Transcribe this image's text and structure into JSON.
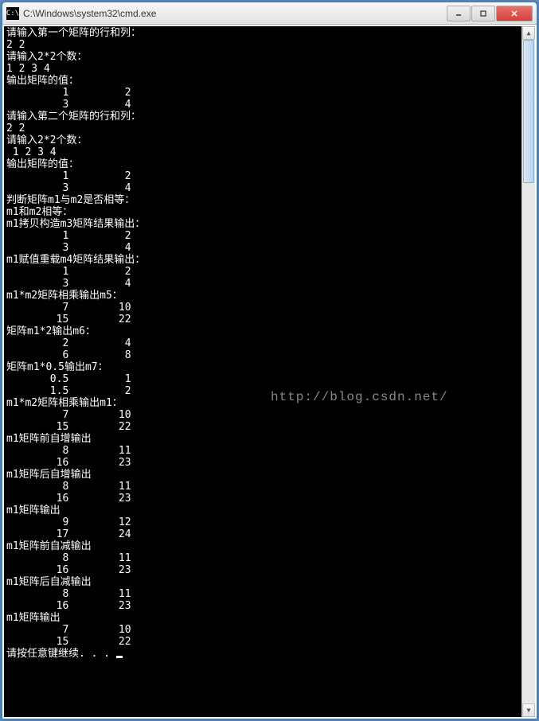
{
  "window": {
    "title": "C:\\Windows\\system32\\cmd.exe",
    "icon_label": "C:\\"
  },
  "controls": {
    "minimize": "—",
    "maximize": "▢",
    "close": "✕"
  },
  "watermark": "http://blog.csdn.net/",
  "console_lines": [
    "请输入第一个矩阵的行和列：",
    "2 2",
    "请输入2*2个数：",
    "1 2 3 4",
    "输出矩阵的值：",
    "         1         2",
    "         3         4",
    "请输入第二个矩阵的行和列：",
    "2 2",
    "请输入2*2个数：",
    " 1 2 3 4",
    "输出矩阵的值：",
    "         1         2",
    "         3         4",
    "判断矩阵m1与m2是否相等：",
    "m1和m2相等：",
    "m1拷贝构造m3矩阵结果输出：",
    "         1         2",
    "         3         4",
    "m1赋值重载m4矩阵结果输出：",
    "         1         2",
    "         3         4",
    "m1*m2矩阵相乘输出m5：",
    "         7        10",
    "        15        22",
    "矩阵m1*2输出m6：",
    "         2         4",
    "         6         8",
    "矩阵m1*0.5输出m7：",
    "       0.5         1",
    "       1.5         2",
    "m1*m2矩阵相乘输出m1：",
    "         7        10",
    "        15        22",
    "m1矩阵前自增输出",
    "         8        11",
    "        16        23",
    "m1矩阵后自增输出",
    "         8        11",
    "        16        23",
    "m1矩阵输出",
    "         9        12",
    "        17        24",
    "m1矩阵前自减输出",
    "         8        11",
    "        16        23",
    "m1矩阵后自减输出",
    "         8        11",
    "        16        23",
    "m1矩阵输出",
    "         7        10",
    "        15        22",
    "请按任意键继续. . . "
  ]
}
